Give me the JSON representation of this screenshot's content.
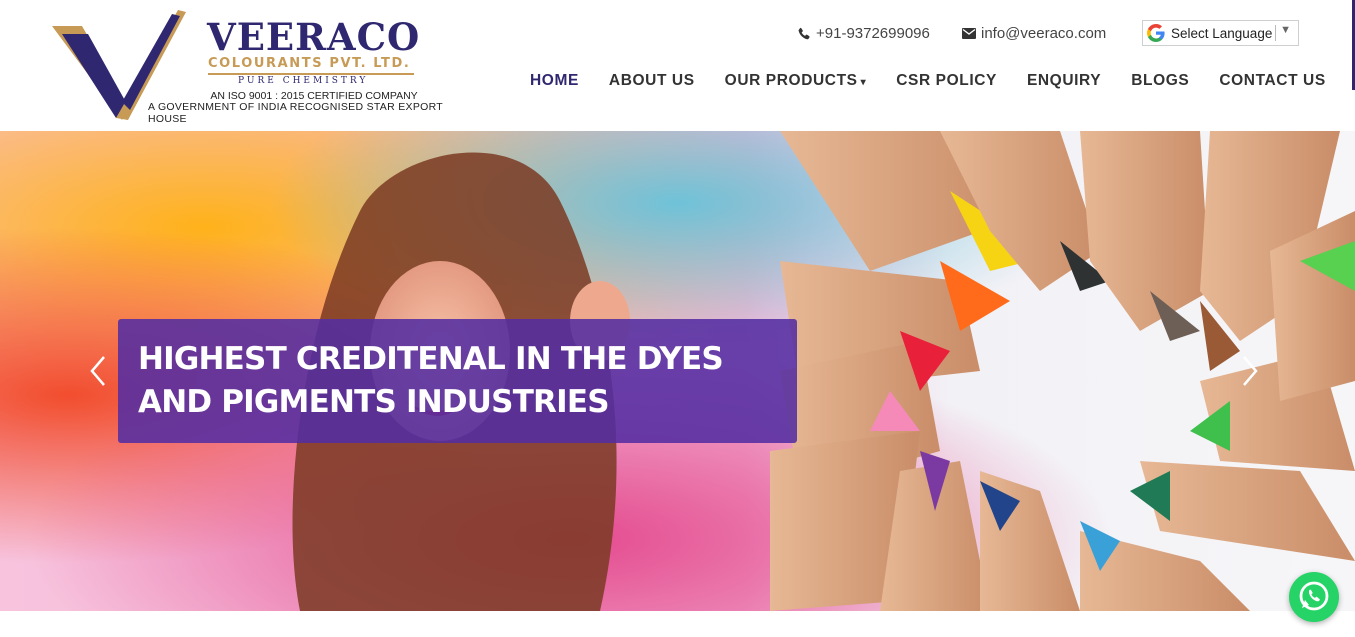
{
  "brand": {
    "name": "VEERACO",
    "subtitle": "COLOURANTS PVT. LTD.",
    "tagline": "PURE CHEMISTRY",
    "line1": "AN ISO 9001 : 2015 CERTIFIED COMPANY",
    "line2": "A GOVERNMENT OF INDIA RECOGNISED STAR EXPORT HOUSE",
    "colors": {
      "primary": "#2f2870",
      "gold": "#c79a56"
    }
  },
  "contact": {
    "phone": "+91-9372699096",
    "phone_icon": "phone-icon",
    "email": "info@veeraco.com",
    "email_icon": "envelope-icon"
  },
  "language": {
    "label": "Select Language",
    "arrow": "▼",
    "icon": "google-icon"
  },
  "nav": {
    "home": "HOME",
    "about": "ABOUT US",
    "products": "OUR PRODUCTS",
    "products_caret": "▾",
    "csr": "CSR POLICY",
    "enquiry": "ENQUIRY",
    "blogs": "BLOGS",
    "contact": "CONTACT US",
    "active": "HOME"
  },
  "hero": {
    "caption": "HIGHEST CREDITENAL IN THE DYES AND PIGMENTS INDUSTRIES",
    "caption_bg": "#542ea2",
    "prev_icon": "chevron-left-icon",
    "next_icon": "chevron-right-icon"
  },
  "widgets": {
    "whatsapp_icon": "whatsapp-icon",
    "whatsapp_color": "#25d366"
  }
}
